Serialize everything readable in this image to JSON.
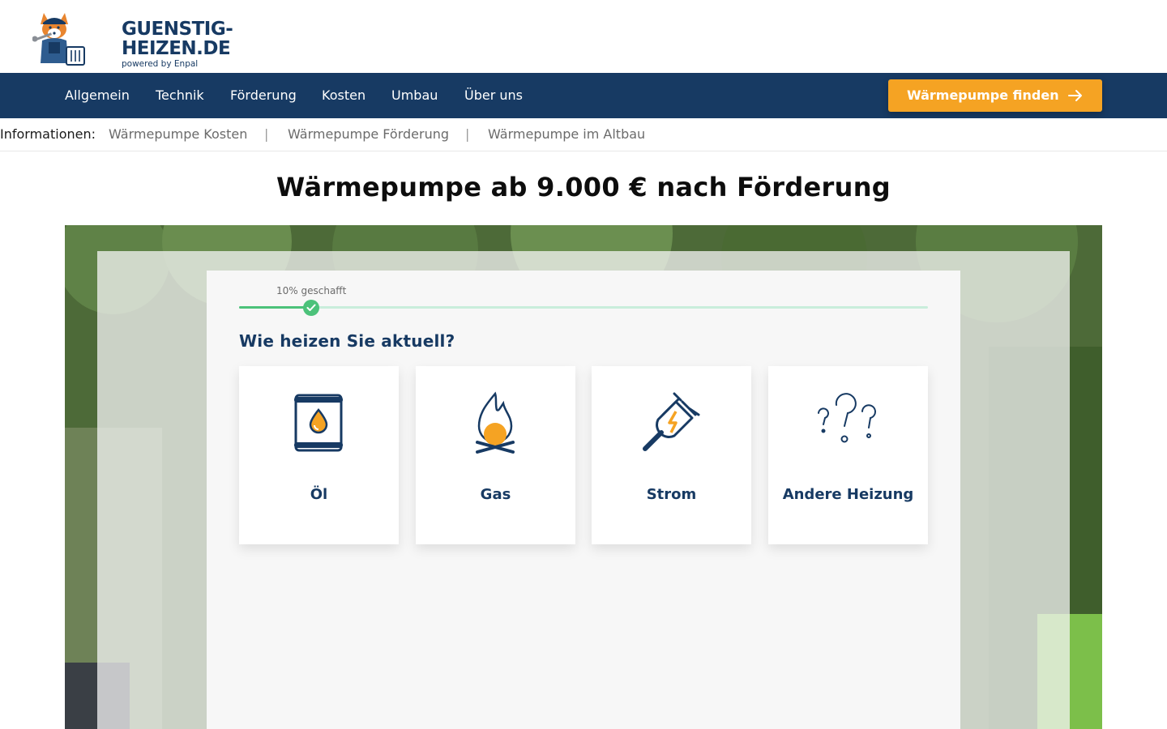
{
  "header": {
    "logo_line1": "GUENSTIG-",
    "logo_line2": "HEIZEN.DE",
    "logo_sub": "powered by Enpal"
  },
  "nav": {
    "items": [
      "Allgemein",
      "Technik",
      "Förderung",
      "Kosten",
      "Umbau",
      "Über uns"
    ],
    "cta_label": "Wärmepumpe finden"
  },
  "infobar": {
    "label": "Informationen:",
    "links": [
      "Wärmepumpe Kosten",
      "Wärmepumpe Förderung",
      "Wärmepumpe im Altbau"
    ],
    "separator": "|"
  },
  "page_title": "Wärmepumpe ab 9.000 € nach Förderung",
  "quiz": {
    "progress_text": "10% geschafft",
    "progress_percent": 10,
    "question": "Wie heizen Sie aktuell?",
    "options": [
      {
        "label": "Öl",
        "icon": "oil-barrel-icon"
      },
      {
        "label": "Gas",
        "icon": "gas-flame-icon"
      },
      {
        "label": "Strom",
        "icon": "electric-plug-icon"
      },
      {
        "label": "Andere Heizung",
        "icon": "question-marks-icon"
      }
    ]
  },
  "colors": {
    "navy": "#173a63",
    "orange": "#f5a323",
    "green": "#4cc27a",
    "track": "#c9eedb"
  }
}
